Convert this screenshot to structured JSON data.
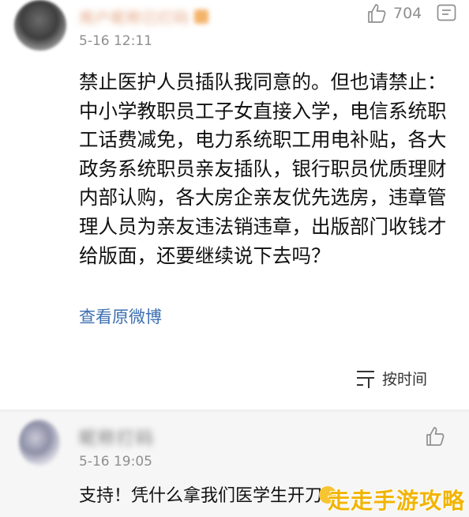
{
  "main_comment": {
    "username": "用户昵称已打码",
    "timestamp": "5-16 12:11",
    "like_count": "704",
    "body": "禁止医护人员插队我同意的。但也请禁止：中小学教职员工子女直接入学，电信系统职工话费减免，电力系统职工用电补贴，各大政务系统职员亲友插队，银行职员优质理财内部认购，各大房企亲友优先选房，违章管理人员为亲友违法销违章，出版部门收钱才给版面，还要继续说下去吗？",
    "view_original_label": "查看原微博",
    "sort_label": "按时间",
    "icons": {
      "like": "thumbs-up-icon",
      "more": "more-icon",
      "sort": "sort-icon"
    }
  },
  "reply": {
    "username": "昵称打码",
    "timestamp": "5-16 19:05",
    "text": "支持！凭什么拿我们医学生开刀",
    "icons": {
      "like": "thumbs-up-icon",
      "emoji": "emoji-icon"
    }
  },
  "watermark": "走走手游攻略",
  "colors": {
    "link": "#3d6fb0",
    "muted": "#8f8f8f",
    "watermark": "#f2b400"
  }
}
